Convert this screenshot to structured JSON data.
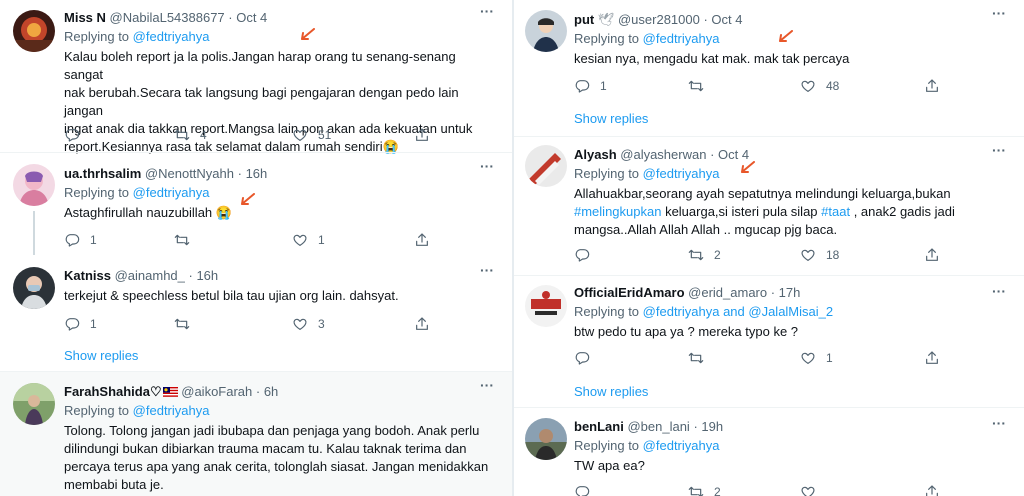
{
  "colors": {
    "accent": "#1d9bf0",
    "muted": "#536471",
    "annotation": "#e8572a"
  },
  "icons": {
    "reply": "reply-icon",
    "retweet": "retweet-icon",
    "like": "like-icon",
    "share": "share-icon",
    "more": "more-icon"
  },
  "left": {
    "t1": {
      "name": "Miss N",
      "handle": "@NabilaL54388677",
      "time": "Oct 4",
      "replying_prefix": "Replying to",
      "mention": "@fedtriyahya",
      "lines": [
        "Kalau boleh report ja la polis.Jangan harap orang tu senang-senang sangat",
        "nak berubah.Secara tak langsung bagi pengajaran dengan pedo lain jangan",
        "ingat anak dia takkan report.Mangsa lain pon akan ada kekuatan untuk",
        "report.Kesiannya rasa tak selamat dalam rumah sendiri😭"
      ],
      "replies": "",
      "retweets": "4",
      "likes": "51"
    },
    "t2": {
      "name": "ua.thrhsalim",
      "handle": "@NenottNyahh",
      "time": "16h",
      "replying_prefix": "Replying to",
      "mention": "@fedtriyahya",
      "text": "Astaghfirullah nauzubillah 😭",
      "replies": "1",
      "retweets": "",
      "likes": "1"
    },
    "t3": {
      "name": "Katniss",
      "handle": "@ainamhd_",
      "time": "16h",
      "text": "terkejut & speechless betul bila tau ujian org lain. dahsyat.",
      "replies": "1",
      "retweets": "",
      "likes": "3",
      "show_replies": "Show replies"
    },
    "t4": {
      "name": "FarahShahida♡",
      "handle": "@aikoFarah",
      "time": "6h",
      "replying_prefix": "Replying to",
      "mention": "@fedtriyahya",
      "lines": [
        "Tolong. Tolong jangan jadi ibubapa dan penjaga yang bodoh. Anak perlu",
        "dilindungi bukan dibiarkan trauma macam tu. Kalau taknak terima dan",
        "percaya terus apa yang anak cerita, tolonglah siasat. Jangan menidakkan",
        "membabi buta je."
      ]
    }
  },
  "right": {
    "t1": {
      "name": "put",
      "handle": "@user281000",
      "time": "Oct 4",
      "replying_prefix": "Replying to",
      "mention": "@fedtriyahya",
      "text": "kesian nya, mengadu kat mak. mak tak percaya",
      "replies": "1",
      "retweets": "",
      "likes": "48",
      "show_replies": "Show replies"
    },
    "t2": {
      "name": "Alyash",
      "handle": "@alyasherwan",
      "time": "Oct 4",
      "replying_prefix": "Replying to",
      "mention": "@fedtriyahya",
      "l1": "Allahuakbar,seorang ayah sepatutnya melindungi keluarga,bukan",
      "l2_tag": "#melingkupkan",
      "l2_mid": " keluarga,si isteri pula silap ",
      "l2_tag2": "#taat",
      "l2_end": " , anak2 gadis jadi",
      "l3": "mangsa..Allah Allah Allah .. mgucap pjg baca.",
      "replies": "",
      "retweets": "2",
      "likes": "18"
    },
    "t3": {
      "name": "OfficialEridAmaro",
      "handle": "@erid_amaro",
      "time": "17h",
      "replying_prefix": "Replying to",
      "mention": "@fedtriyahya and @JalalMisai_2",
      "text": "btw pedo tu apa ya ? mereka typo ke ?",
      "replies": "",
      "retweets": "",
      "likes": "1",
      "show_replies": "Show replies"
    },
    "t4": {
      "name": "benLani",
      "handle": "@ben_lani",
      "time": "19h",
      "replying_prefix": "Replying to",
      "mention": "@fedtriyahya",
      "text": "TW apa ea?",
      "replies": "",
      "retweets": "2",
      "likes": ""
    }
  }
}
